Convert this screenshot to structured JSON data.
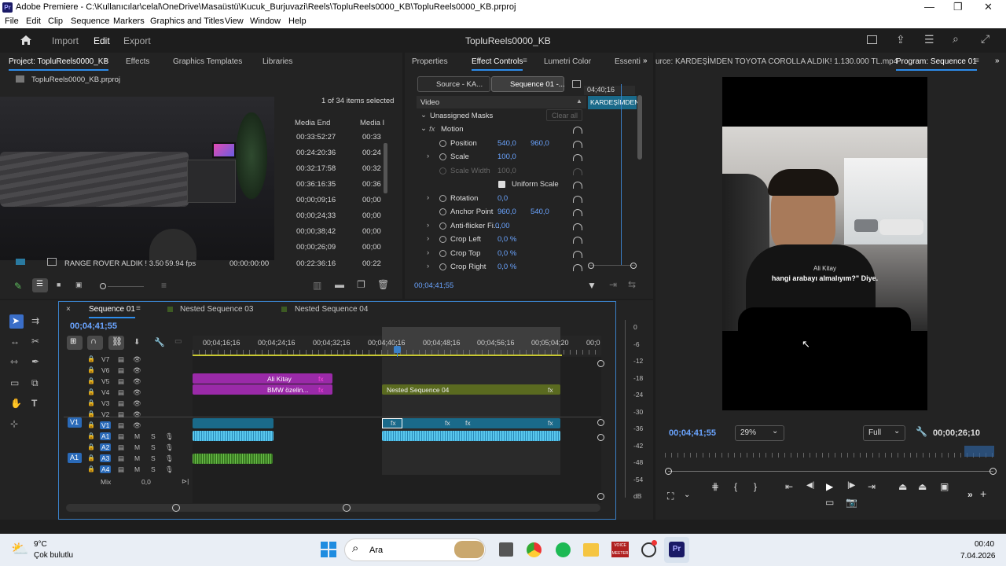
{
  "window": {
    "title": "Adobe Premiere - C:\\Kullanıcılar\\celal\\OneDrive\\Masaüstü\\Kucuk_Burjuvazi\\Reels\\TopluReels0000_KB\\TopluReels0000_KB.prproj",
    "logo": "Pr",
    "minimize": "—",
    "maximize": "❐",
    "close": "✕"
  },
  "menu": [
    "File",
    "Edit",
    "Clip",
    "Sequence",
    "Markers",
    "Graphics and Titles",
    "View",
    "Window",
    "Help"
  ],
  "header": {
    "home_icon": "home-icon",
    "import": "Import",
    "edit": "Edit",
    "export": "Export",
    "project_name": "TopluReels0000_KB"
  },
  "project_panel": {
    "tabs": [
      "Project: TopluReels0000_KB",
      "Effects",
      "Graphics Templates",
      "Libraries"
    ],
    "file": "TopluReels0000_KB.prproj",
    "selection": "1 of 34 items selected",
    "col_media_end": "Media End",
    "col_media_i": "Media I",
    "rows": [
      {
        "end": "00:33:52:27",
        "i": "00:33"
      },
      {
        "end": "00:24:20:36",
        "i": "00:24"
      },
      {
        "end": "00:32:17:58",
        "i": "00:32"
      },
      {
        "end": "00:36:16:35",
        "i": "00:36"
      },
      {
        "end": "00;00;09;16",
        "i": "00;00"
      },
      {
        "end": "00;00;24;33",
        "i": "00;00"
      },
      {
        "end": "00;00;38;42",
        "i": "00;00"
      },
      {
        "end": "00;00;26;09",
        "i": "00;00"
      },
      {
        "end": "00:22:36:16",
        "i": "00:22"
      }
    ],
    "bottom_row": {
      "name": "RANGE ROVER ALDIK ! 3.50",
      "fps": "59.94 fps",
      "start": "00:00:00:00"
    }
  },
  "effect_controls": {
    "tabs": [
      "Properties",
      "Effect Controls",
      "Lumetri Color",
      "Essenti"
    ],
    "source_btn": "Source - KA...",
    "seq_btn": "Sequence 01 -...",
    "mini_time": "04;40;16",
    "mini_clip": "KARDEŞİMDEN",
    "video_label": "Video",
    "unassigned": "Unassigned Masks",
    "clear_all": "Clear all",
    "motion": "Motion",
    "fx": "fx",
    "props": [
      {
        "name": "Position",
        "v1": "540,0",
        "v2": "960,0"
      },
      {
        "name": "Scale",
        "v1": "100,0",
        "v2": ""
      },
      {
        "name": "Scale Width",
        "v1": "100,0",
        "v2": ""
      },
      {
        "name": "Uniform Scale",
        "v1": "",
        "v2": ""
      },
      {
        "name": "Rotation",
        "v1": "0,0",
        "v2": ""
      },
      {
        "name": "Anchor Point",
        "v1": "960,0",
        "v2": "540,0"
      },
      {
        "name": "Anti-flicker Fi...",
        "v1": "0,00",
        "v2": ""
      },
      {
        "name": "Crop Left",
        "v1": "0,0 %",
        "v2": ""
      },
      {
        "name": "Crop Top",
        "v1": "0,0 %",
        "v2": ""
      },
      {
        "name": "Crop Right",
        "v1": "0,0 %",
        "v2": ""
      }
    ],
    "timecode": "00;04;41;55"
  },
  "program": {
    "source_tab": "urce: KARDEŞİMDEN TOYOTA COROLLA ALDIK! 1.130.000 TL.mp4",
    "program_tab": "Program: Sequence 01",
    "caption_name": "Ali Kitay",
    "caption_text": "hangi arabayı almalıyım?\" Diye.",
    "timecode": "00;04;41;55",
    "zoom": "29%",
    "quality": "Full",
    "duration": "00;00;26;10"
  },
  "timeline": {
    "tabs": [
      "Sequence 01",
      "Nested Sequence 03",
      "Nested Sequence 04"
    ],
    "timecode": "00;04;41;55",
    "ruler": [
      "00;04;16;16",
      "00;04;24;16",
      "00;04;32;16",
      "00;04;40;16",
      "00;04;48;16",
      "00;04;56;16",
      "00;05;04;20",
      "00;0"
    ],
    "video_tracks": [
      "V7",
      "V6",
      "V5",
      "V4",
      "V3",
      "V2",
      "V1"
    ],
    "audio_tracks": [
      "A1",
      "A2",
      "A3",
      "A4"
    ],
    "src_v": "V1",
    "src_a": "A1",
    "mix": "Mix",
    "mix_val": "0,0",
    "clip_v5": "Ali Kitay",
    "clip_v4": "BMW özelin...",
    "clip_nested": "Nested Sequence 04",
    "fx": "fx",
    "meter_db": [
      "0",
      "-6",
      "-12",
      "-18",
      "-24",
      "-30",
      "-36",
      "-42",
      "-48",
      "-54",
      "dB"
    ]
  },
  "taskbar": {
    "temp": "9°C",
    "weather": "Çok bulutlu",
    "search": "Ara",
    "time": "00:40",
    "date": "7.04.2026",
    "voicemeeter": "VOICE MEETER",
    "premiere": "Pr"
  }
}
